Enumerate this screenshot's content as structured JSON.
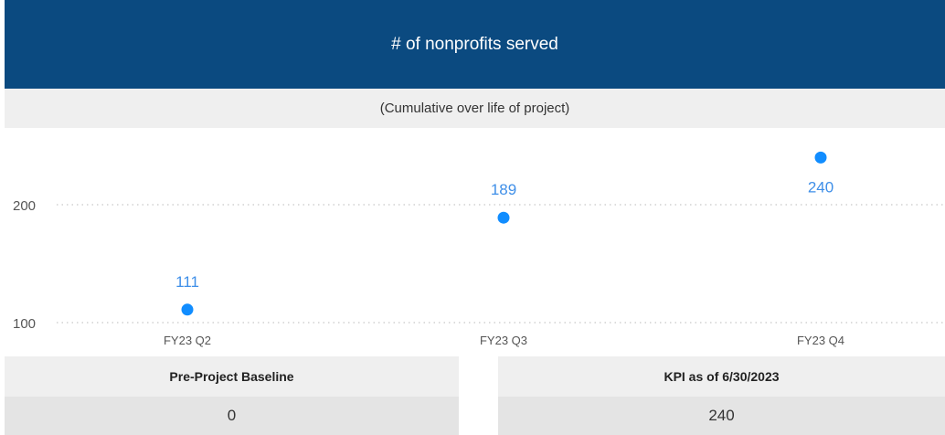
{
  "header": {
    "title": "# of nonprofits served"
  },
  "subheader": {
    "text": "(Cumulative over life of project)"
  },
  "chart_data": {
    "type": "scatter",
    "categories": [
      "FY23 Q2",
      "FY23 Q3",
      "FY23 Q4"
    ],
    "values": [
      111,
      189,
      240
    ],
    "data_labels": [
      "111",
      "189",
      "240"
    ],
    "yticks": [
      100,
      200
    ],
    "ylim": [
      100,
      255
    ],
    "grid": true,
    "point_color": "#118dff",
    "label_color": "#3f8fe8"
  },
  "cards": {
    "baseline": {
      "label": "Pre-Project Baseline",
      "value": "0"
    },
    "kpi": {
      "label": "KPI as of 6/30/2023",
      "value": "240"
    }
  }
}
